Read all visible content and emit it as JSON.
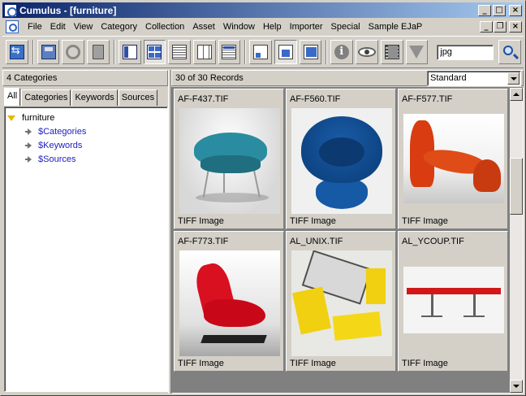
{
  "window": {
    "title": "Cumulus - [furniture]",
    "controls": {
      "minimize": "_",
      "maximize": "□",
      "close": "×"
    }
  },
  "menubar": {
    "items": [
      {
        "id": "file",
        "label": "File"
      },
      {
        "id": "edit",
        "label": "Edit"
      },
      {
        "id": "view",
        "label": "View"
      },
      {
        "id": "category",
        "label": "Category"
      },
      {
        "id": "collection",
        "label": "Collection"
      },
      {
        "id": "asset",
        "label": "Asset"
      },
      {
        "id": "window",
        "label": "Window"
      },
      {
        "id": "help",
        "label": "Help"
      },
      {
        "id": "importer",
        "label": "Importer"
      },
      {
        "id": "special",
        "label": "Special"
      },
      {
        "id": "sample-ejap",
        "label": "Sample EJaP"
      }
    ],
    "doc_controls": {
      "minimize": "_",
      "restore": "❐",
      "close": "×"
    }
  },
  "toolbar": {
    "search_value": "jpg",
    "buttons": [
      {
        "name": "synchronize-button-icon",
        "group": 1
      },
      {
        "name": "catalog-disk-icon",
        "group": 2
      },
      {
        "name": "settings-gear-icon",
        "group": 2
      },
      {
        "name": "trash-icon",
        "group": 2
      },
      {
        "name": "show-panel-icon",
        "group": 3
      },
      {
        "name": "thumbnail-grid-icon",
        "group": 3,
        "pressed": true
      },
      {
        "name": "list-view-icon",
        "group": 3
      },
      {
        "name": "column-view-icon",
        "group": 3
      },
      {
        "name": "detail-view-icon",
        "group": 3
      },
      {
        "name": "small-thumbnail-icon",
        "group": 4
      },
      {
        "name": "medium-thumbnail-icon",
        "group": 4,
        "pressed": true
      },
      {
        "name": "large-thumbnail-icon",
        "group": 4
      },
      {
        "name": "info-icon",
        "group": 5
      },
      {
        "name": "preview-eye-icon",
        "group": 5
      },
      {
        "name": "filmstrip-icon",
        "group": 5
      },
      {
        "name": "filter-funnel-icon",
        "group": 5
      }
    ]
  },
  "left_pane": {
    "header": "4 Categories",
    "tabs": [
      {
        "id": "all",
        "label": "All",
        "active": true
      },
      {
        "id": "categories",
        "label": "Categories"
      },
      {
        "id": "keywords",
        "label": "Keywords"
      },
      {
        "id": "sources",
        "label": "Sources"
      }
    ],
    "tree": {
      "root": "furniture",
      "children": [
        "$Categories",
        "$Keywords",
        "$Sources"
      ]
    }
  },
  "right_pane": {
    "header": "30 of 30 Records",
    "view_select": "Standard",
    "records": [
      {
        "name": "AF-F437.TIF",
        "type": "TIFF Image",
        "thumb": "teal-chair"
      },
      {
        "name": "AF-F560.TIF",
        "type": "TIFF Image",
        "thumb": "blue-bowl-chair"
      },
      {
        "name": "AF-F577.TIF",
        "type": "TIFF Image",
        "thumb": "orange-lounge"
      },
      {
        "name": "AF-F773.TIF",
        "type": "TIFF Image",
        "thumb": "red-lounge-chair"
      },
      {
        "name": "AL_UNIX.TIF",
        "type": "TIFF Image",
        "thumb": "yellow-modules"
      },
      {
        "name": "AL_YCOUP.TIF",
        "type": "TIFF Image",
        "thumb": "red-bench"
      }
    ]
  },
  "colors": {
    "titlebar_start": "#0a246a",
    "titlebar_end": "#a6caf0",
    "face": "#d4d0c8",
    "link_blue": "#2020c0"
  }
}
